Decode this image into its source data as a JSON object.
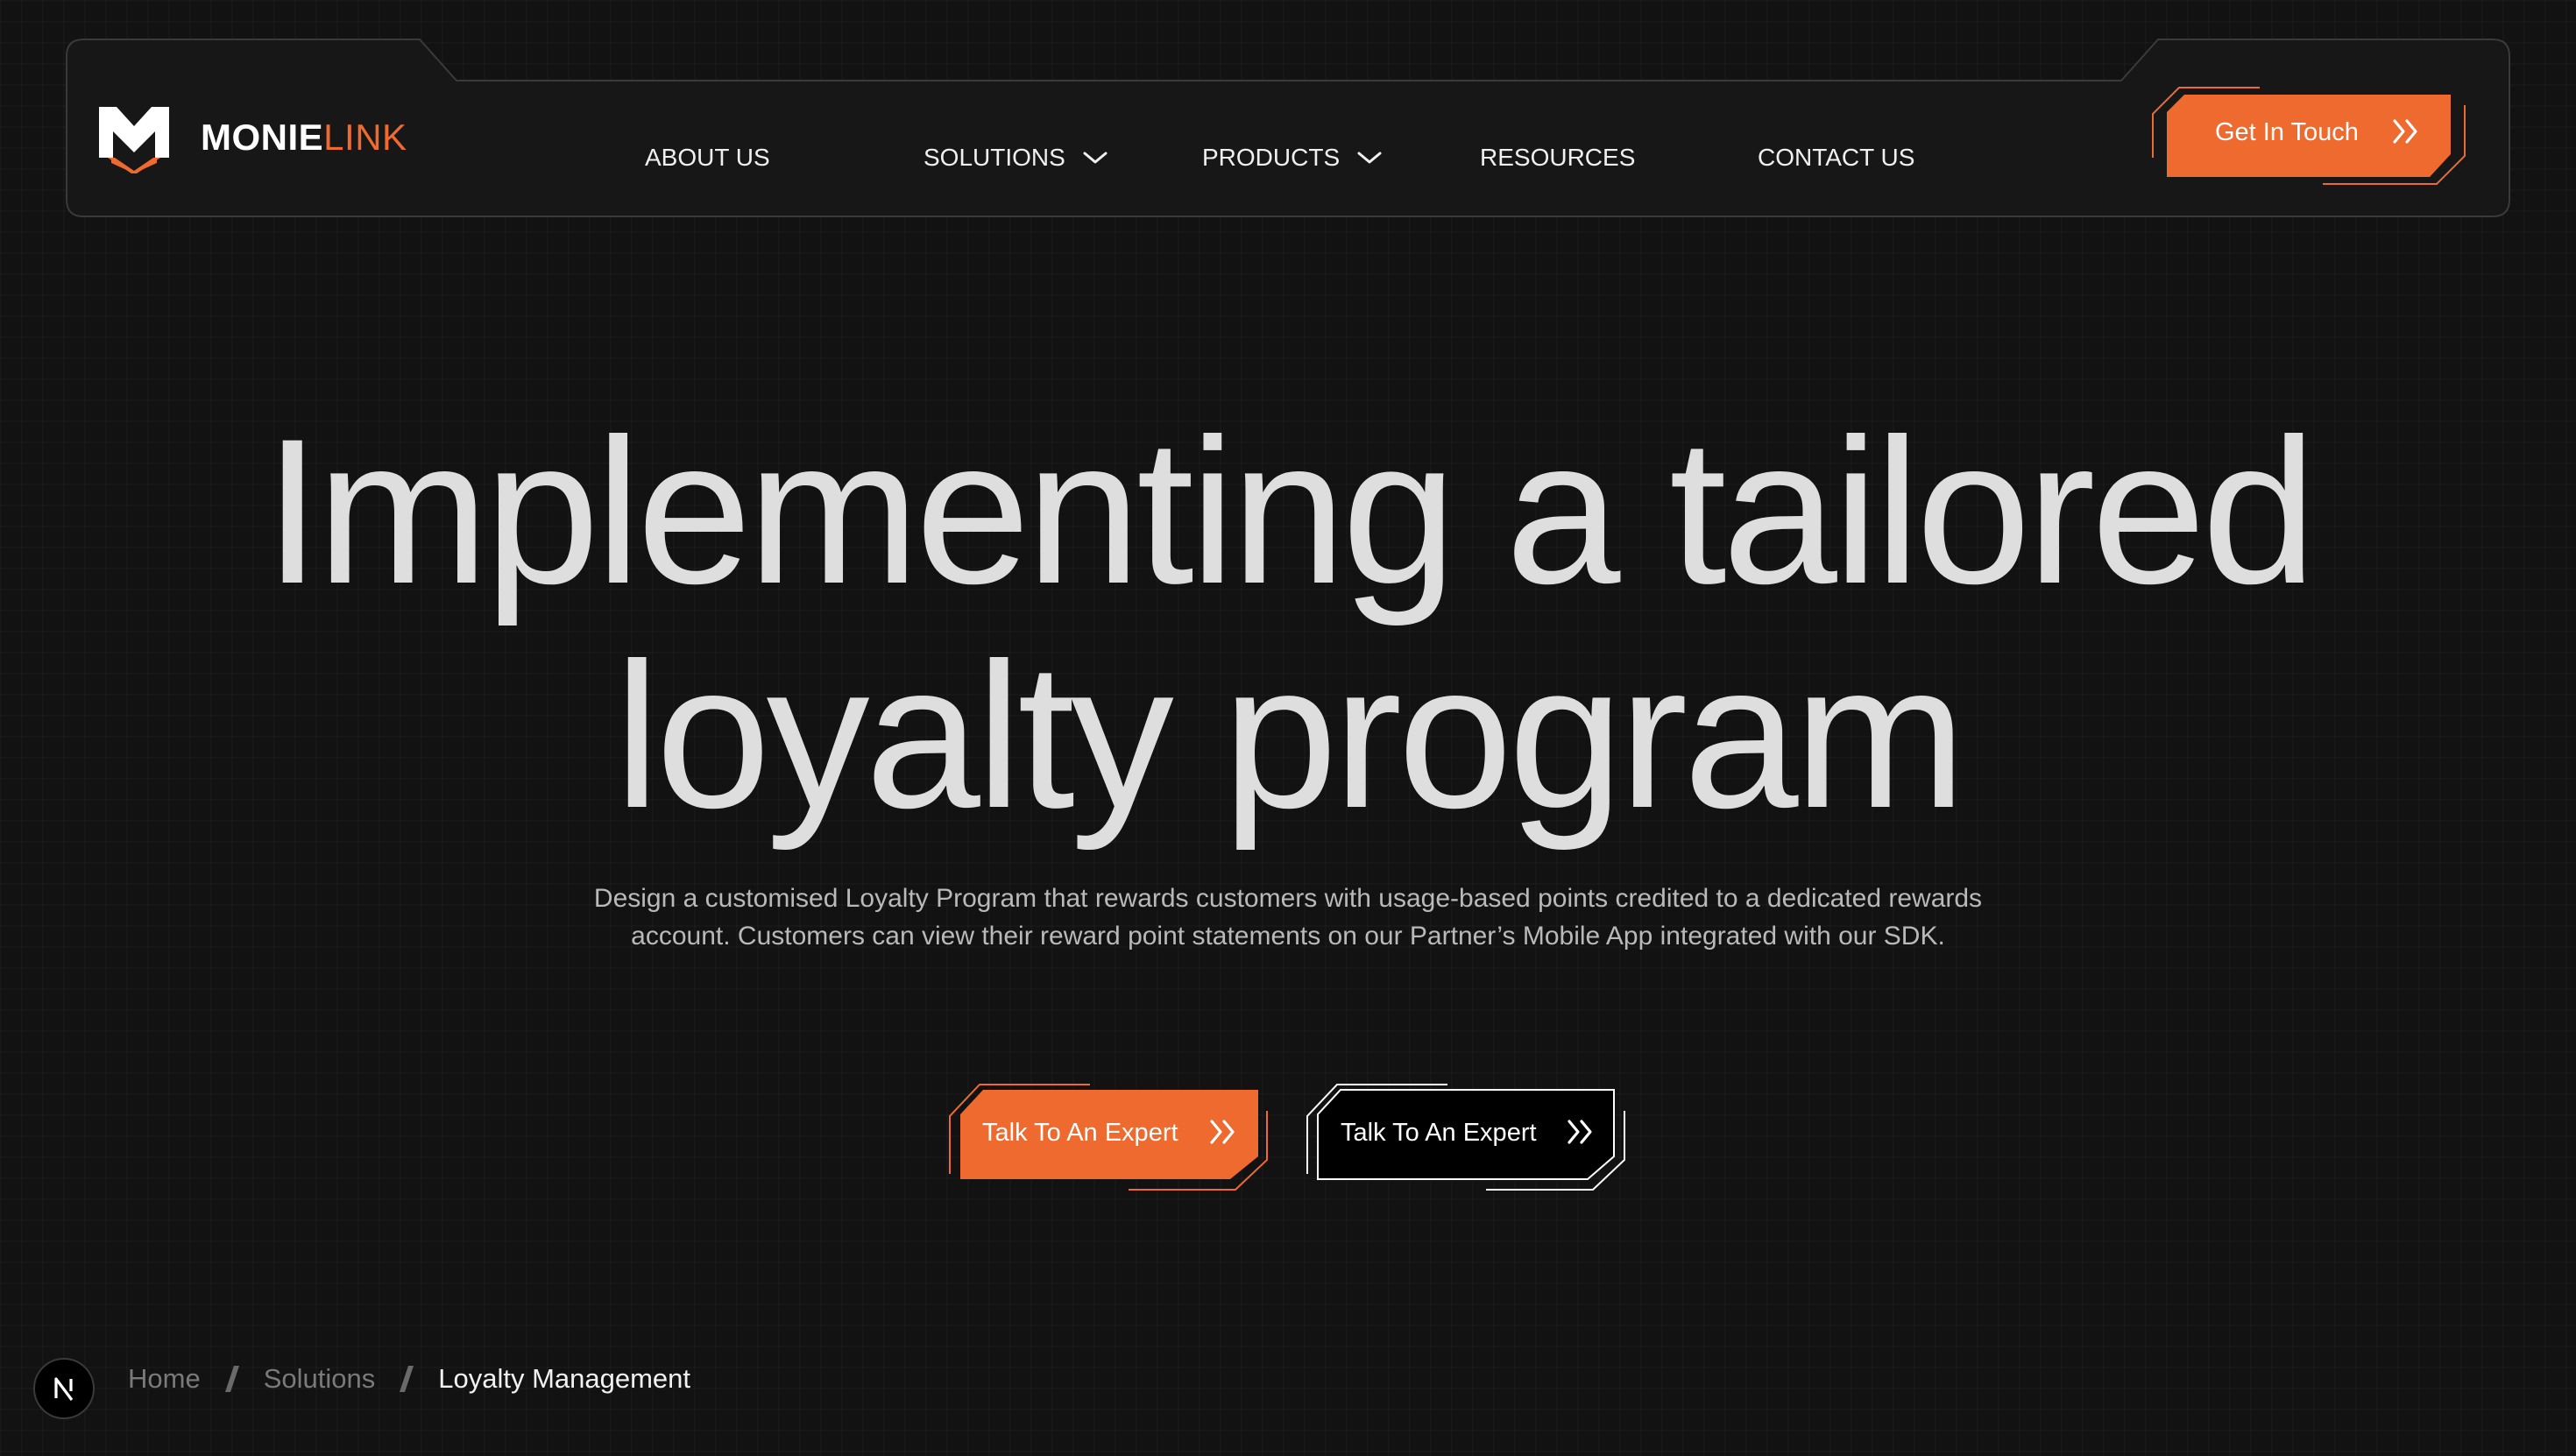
{
  "brand": {
    "name_part1": "MONIE",
    "name_part2": "LINK",
    "accent_color": "#ef6a2f"
  },
  "nav": {
    "items": [
      {
        "label": "ABOUT US",
        "has_dropdown": false
      },
      {
        "label": "SOLUTIONS",
        "has_dropdown": true
      },
      {
        "label": "PRODUCTS",
        "has_dropdown": true
      },
      {
        "label": "RESOURCES",
        "has_dropdown": false
      },
      {
        "label": "CONTACT US",
        "has_dropdown": false
      }
    ],
    "cta_label": "Get In Touch",
    "cta_icon": "double-chevron-right-icon"
  },
  "hero": {
    "title_line1": "Implementing a tailored",
    "title_line2": "loyalty program",
    "description": "Design a customised Loyalty Program that rewards customers with usage-based points credited to a dedicated rewards account. Customers can view their reward point statements on our Partner’s Mobile App integrated with our SDK.",
    "primary_button": "Talk To An Expert",
    "secondary_button": "Talk To An Expert"
  },
  "breadcrumb": {
    "items": [
      "Home",
      "Solutions",
      "Loyalty Management"
    ]
  },
  "dev_badge": {
    "icon": "nextjs-icon",
    "letter": "N"
  },
  "colors": {
    "background": "#121212",
    "accent": "#ef6a2f",
    "text": "#dedede",
    "muted": "#7a7a7a"
  }
}
